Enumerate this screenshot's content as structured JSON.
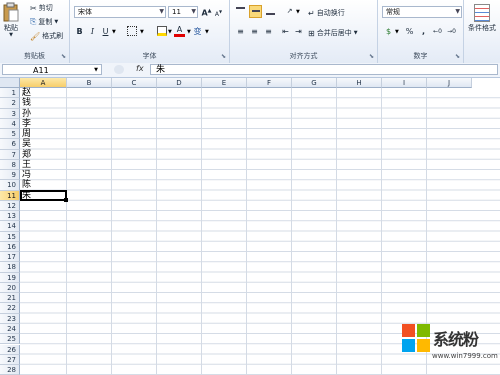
{
  "ribbon": {
    "clipboard": {
      "paste": "粘贴",
      "cut": "剪切",
      "copy": "复制",
      "format_painter": "格式刷",
      "group": "剪贴板"
    },
    "font": {
      "name": "宋体",
      "size": "11",
      "grow": "A",
      "shrink": "A",
      "bold": "B",
      "italic": "I",
      "underline": "U",
      "wen": "变",
      "group": "字体"
    },
    "alignment": {
      "wrap": "自动换行",
      "merge": "合并后居中",
      "group": "对齐方式"
    },
    "number": {
      "format": "常规",
      "currency": "$",
      "percent": "%",
      "comma": ",",
      "group": "数字"
    },
    "styles": {
      "conditional": "条件格式"
    }
  },
  "formula_bar": {
    "name_box": "A11",
    "fx": "fx",
    "content": "朱"
  },
  "sheet": {
    "columns": [
      "A",
      "B",
      "C",
      "D",
      "E",
      "F",
      "G",
      "H",
      "I",
      "J"
    ],
    "selected_column": "A",
    "rows": [
      "1",
      "2",
      "3",
      "4",
      "5",
      "6",
      "7",
      "8",
      "9",
      "10",
      "11",
      "12",
      "13",
      "14",
      "15",
      "16",
      "17",
      "18",
      "19",
      "20",
      "21",
      "22",
      "23",
      "24",
      "25",
      "26",
      "27",
      "28"
    ],
    "selected_row": "11",
    "cells_a": [
      "赵",
      "钱",
      "孙",
      "李",
      "周",
      "吴",
      "郑",
      "王",
      "冯",
      "陈",
      "朱"
    ]
  },
  "watermark": {
    "brand": "系统粉",
    "url": "www.win7999.com",
    "colors": [
      "#f25022",
      "#7fba00",
      "#00a4ef",
      "#ffb900"
    ]
  }
}
